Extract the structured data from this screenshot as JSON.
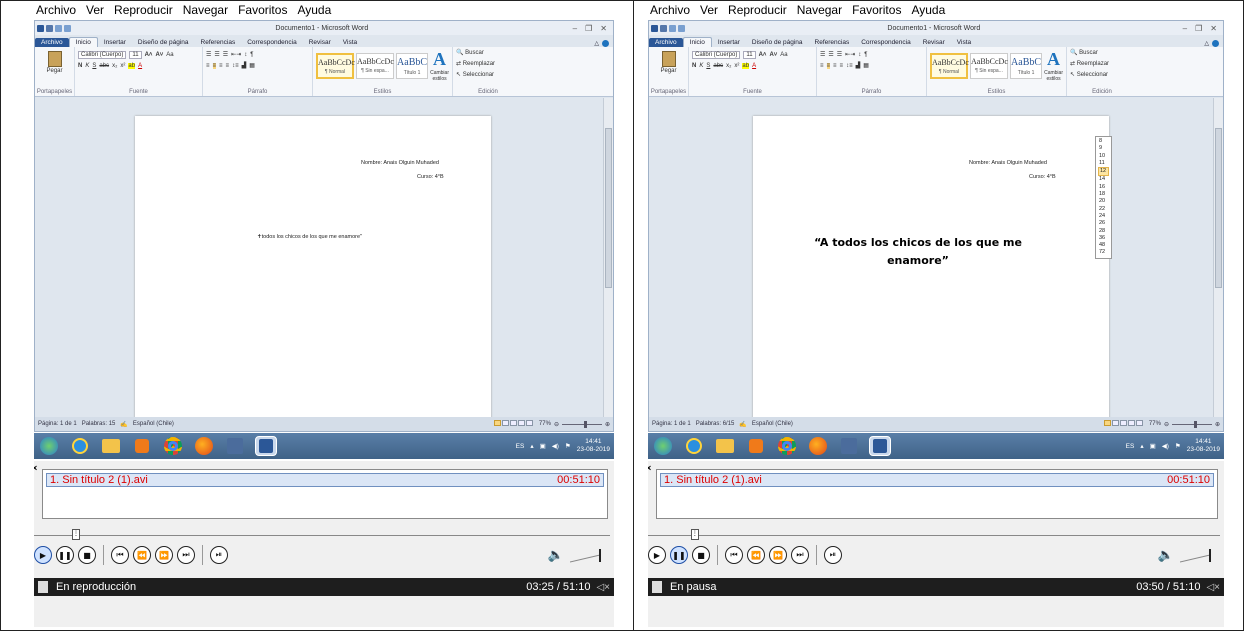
{
  "panes": [
    {
      "id": "left",
      "menubar": [
        "Archivo",
        "Ver",
        "Reproducir",
        "Navegar",
        "Favoritos",
        "Ayuda"
      ],
      "word": {
        "title": "Documento1 - Microsoft Word",
        "tabs": [
          "Archivo",
          "Inicio",
          "Insertar",
          "Diseño de página",
          "Referencias",
          "Correspondencia",
          "Revisar",
          "Vista"
        ],
        "active_tab": "Inicio",
        "font_name": "Calibri (Cuerpo)",
        "font_size": "11",
        "groups": [
          "Portapapeles",
          "Fuente",
          "Párrafo",
          "Estilos",
          "Edición"
        ],
        "paste_label": "Pegar",
        "styles": [
          {
            "preview": "AaBbCcDc",
            "name": "¶ Normal"
          },
          {
            "preview": "AaBbCcDc",
            "name": "¶ Sin espa..."
          },
          {
            "preview": "AaBbC",
            "name": "Título 1"
          }
        ],
        "change_styles": "Cambiar estilos",
        "edit_items": [
          "Buscar",
          "Reemplazar",
          "Seleccionar"
        ],
        "doc": {
          "name_line": "Nombre: Anais Olguin Muhaded",
          "course_line": "Curso: 4°B",
          "body": "todos los chicos de los que me enamore\""
        },
        "status": {
          "page": "Página: 1 de 1",
          "words": "Palabras: 15",
          "lang": "Español (Chile)",
          "zoom": "77%"
        }
      },
      "taskbar": {
        "lang": "ES",
        "time": "14:41",
        "date": "23-08-2019"
      },
      "player": {
        "playlist_item": "1. Sin título 2 (1).avi",
        "duration": "00:51:10",
        "seek_fraction": 0.066,
        "status": "En reproducción",
        "time": "03:25 / 51:10",
        "active_button": "play"
      }
    },
    {
      "id": "right",
      "menubar": [
        "Archivo",
        "Ver",
        "Reproducir",
        "Navegar",
        "Favoritos",
        "Ayuda"
      ],
      "word": {
        "title": "Documento1 - Microsoft Word",
        "tabs": [
          "Archivo",
          "Inicio",
          "Insertar",
          "Diseño de página",
          "Referencias",
          "Correspondencia",
          "Revisar",
          "Vista"
        ],
        "active_tab": "Inicio",
        "font_name": "Calibri (Cuerpo)",
        "font_size": "11",
        "groups": [
          "Portapapeles",
          "Fuente",
          "Párrafo",
          "Estilos",
          "Edición"
        ],
        "paste_label": "Pegar",
        "styles": [
          {
            "preview": "AaBbCcDc",
            "name": "¶ Normal"
          },
          {
            "preview": "AaBbCcDc",
            "name": "¶ Sin espa..."
          },
          {
            "preview": "AaBbC",
            "name": "Título 1"
          }
        ],
        "change_styles": "Cambiar estilos",
        "edit_items": [
          "Buscar",
          "Reemplazar",
          "Seleccionar"
        ],
        "doc": {
          "name_line": "Nombre: Anais Olguin Muhaded",
          "course_line": "Curso: 4°B",
          "title_line1": "“A todos los chicos de los que me",
          "title_line2": "enamore”"
        },
        "font_sizes": [
          "8",
          "9",
          "10",
          "11",
          "12",
          "14",
          "16",
          "18",
          "20",
          "22",
          "24",
          "26",
          "28",
          "36",
          "48",
          "72"
        ],
        "font_size_highlight": "12",
        "status": {
          "page": "Página: 1 de 1",
          "words": "Palabras: 6/15",
          "lang": "Español (Chile)",
          "zoom": "77%"
        }
      },
      "taskbar": {
        "lang": "ES",
        "time": "14:41",
        "date": "23-08-2019"
      },
      "player": {
        "playlist_item": "1. Sin título 2 (1).avi",
        "duration": "00:51:10",
        "seek_fraction": 0.075,
        "status": "En pausa",
        "time": "03:50 / 51:10",
        "active_button": "pause"
      }
    }
  ],
  "colors": {
    "file_tab": "#2b5797",
    "playlist_text": "#dd0000",
    "taskbar": "#4a6f97"
  }
}
